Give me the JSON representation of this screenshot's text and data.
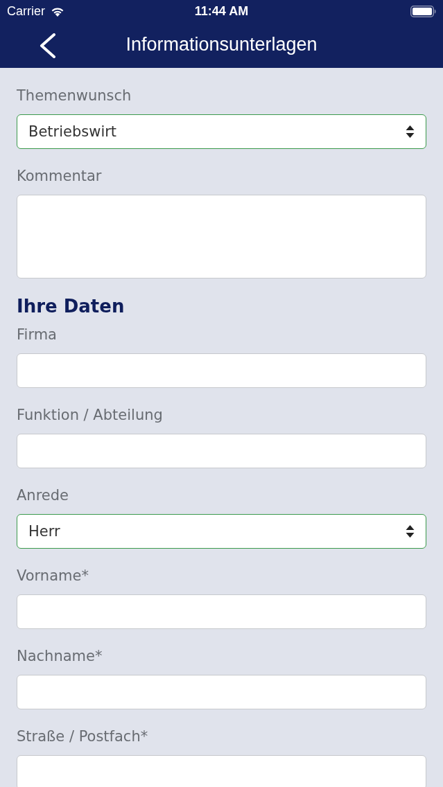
{
  "status_bar": {
    "carrier": "Carrier",
    "time": "11:44 AM"
  },
  "nav_bar": {
    "title": "Informationsunterlagen"
  },
  "form": {
    "items": [
      {
        "kind": "select",
        "label": "Themenwunsch",
        "value": "Betriebswirt"
      },
      {
        "kind": "textarea",
        "label": "Kommentar"
      },
      {
        "kind": "heading",
        "text": "Ihre Daten"
      },
      {
        "kind": "input",
        "label": "Firma"
      },
      {
        "kind": "input",
        "label": "Funktion / Abteilung"
      },
      {
        "kind": "select",
        "label": "Anrede",
        "value": "Herr"
      },
      {
        "kind": "input",
        "label": "Vorname*"
      },
      {
        "kind": "input",
        "label": "Nachname*"
      },
      {
        "kind": "input",
        "label": "Straße / Postfach*"
      }
    ]
  }
}
